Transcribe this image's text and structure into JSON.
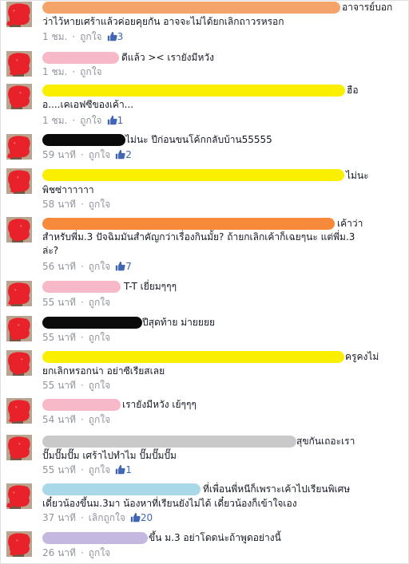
{
  "comments": [
    {
      "lines": [
        "อาจารย์บอก",
        "ว่าไว้หายเศร้าแล้วค่อยคุยกัน อาจจะไม่ได้ยกเลิกถาวรหรอก"
      ],
      "time": "1 ชม.",
      "like": "ถูกใจ",
      "likes": "3"
    },
    {
      "lines": [
        "ดีแล้ว >< เรายังมีหวัง"
      ],
      "time": "1 ชม.",
      "like": "ถูกใจ",
      "likes": ""
    },
    {
      "lines": [
        "ฮือ",
        "อ....เคเอฟซีของเค้า..."
      ],
      "time": "1 ชม.",
      "like": "ถูกใจ",
      "likes": "1"
    },
    {
      "lines": [
        "ไม่นะ ปีก่อนขนโค้กกลับบ้าน55555"
      ],
      "time": "59 นาที",
      "like": "ถูกใจ",
      "likes": "2"
    },
    {
      "lines": [
        "ไม่นะ",
        "พิชซ่าาาาาา"
      ],
      "time": "58 นาที",
      "like": "ถูกใจ",
      "likes": ""
    },
    {
      "lines": [
        "เค้าว่า",
        "สำหรับพี่ม.3 ปัจฉิมมันสำคัญกว่าเรื่องกินมั้ย? ถ้ายกเลิกเค้าก็เฉยๆนะ แต่พี่ม.3",
        "ล่ะ?"
      ],
      "time": "56 นาที",
      "like": "ถูกใจ",
      "likes": "7"
    },
    {
      "lines": [
        "T-T เยี่ยมๆๆๆ"
      ],
      "time": "55 นาที",
      "like": "ถูกใจ",
      "likes": ""
    },
    {
      "lines": [
        "ปีสุดท้าย ม่ายยยย"
      ],
      "time": "55 นาที",
      "like": "ถูกใจ",
      "likes": ""
    },
    {
      "lines": [
        "ครูคงไม่",
        "ยกเลิกหรอกน่า อย่าซีเรียสเลย"
      ],
      "time": "55 นาที",
      "like": "ถูกใจ",
      "likes": ""
    },
    {
      "lines": [
        "เรายังมีหวัง เย้ๆๆๆ"
      ],
      "time": "54 นาที",
      "like": "ถูกใจ",
      "likes": ""
    },
    {
      "lines": [
        "สุขกันเถอะเรา",
        "ปั๊มปั๊มปั๊ม เศร้าไปทำไม ปั๊มปั๊มปั๊ม"
      ],
      "time": "55 นาที",
      "like": "ถูกใจ",
      "likes": "1"
    },
    {
      "lines": [
        "ที่เพื่อนพี่หนีก็เพราะเค้าไปเรียนพิเศษ",
        "เดี๋ยวน้องขึ้นม.3มา น้องหาที่เรียนยังไม่ได้ เดี๋ยวน้องก็เข้าใจเอง"
      ],
      "time": "37 นาที",
      "like": "เลิกถูกใจ",
      "likes": "20"
    },
    {
      "lines": [
        "ขึ้น ม.3 อย่าโดดน่ะถ้าพูดอย่างนี้"
      ],
      "time": "26 นาที",
      "like": "ถูกใจ",
      "likes": ""
    }
  ],
  "colors": {
    "link": "#4267b2",
    "meta": "#90949c",
    "text": "#141823",
    "avatar_blot": "#e8212a"
  },
  "icons": {
    "like": "thumbs-up-icon",
    "avatar": "avatar-redacted"
  }
}
